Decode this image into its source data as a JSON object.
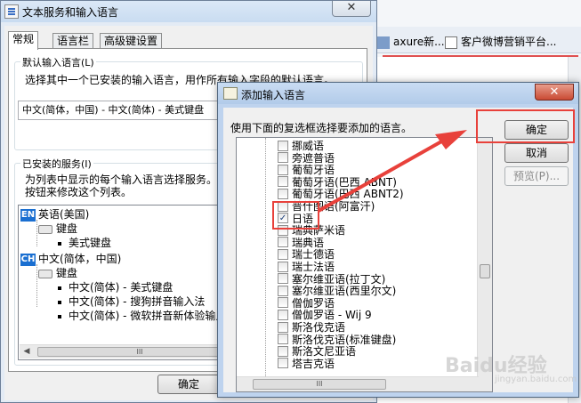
{
  "background": {
    "tabs": [
      {
        "label": "axure新..."
      },
      {
        "label": "客户微博营销平台..."
      }
    ]
  },
  "main_window": {
    "title": "文本服务和输入语言",
    "close_glyph": "✕",
    "tabs": [
      {
        "label": "常规",
        "active": true
      },
      {
        "label": "语言栏",
        "active": false
      },
      {
        "label": "高级键设置",
        "active": false
      }
    ],
    "default_group": {
      "title": "默认输入语言(L)",
      "description": "选择其中一个已安装的输入语言，用作所有输入字段的默认语言。",
      "selected_value": "中文(简体，中国) - 中文(简体) - 美式键盘"
    },
    "installed_group": {
      "title": "已安装的服务(I)",
      "description_line1": "为列表中显示的每个输入语言选择服务。使用\"添加\"和\"删除\"",
      "description_line2": "按钮来修改这个列表。",
      "items": [
        {
          "badge": "EN",
          "label": "英语(美国)"
        },
        {
          "label": "键盘"
        },
        {
          "label": "美式键盘"
        },
        {
          "badge": "CH",
          "label": "中文(简体，中国)"
        },
        {
          "label": "键盘"
        },
        {
          "label": "中文(简体) - 美式键盘"
        },
        {
          "label": "中文(简体) - 搜狗拼音输入法"
        },
        {
          "label": "中文(简体) - 微软拼音新体验输入风格"
        }
      ],
      "scroll_grip": "III"
    },
    "ok_button": "确定"
  },
  "add_dialog": {
    "title": "添加输入语言",
    "close_glyph": "✕",
    "prompt": "使用下面的复选框选择要添加的语言。",
    "languages": [
      {
        "label": "挪威语",
        "checked": false
      },
      {
        "label": "旁遮普语",
        "checked": false
      },
      {
        "label": "葡萄牙语",
        "checked": false
      },
      {
        "label": "葡萄牙语(巴西 ABNT)",
        "checked": false
      },
      {
        "label": "葡萄牙语(巴西 ABNT2)",
        "checked": false
      },
      {
        "label": "普什图语(阿富汗)",
        "checked": false
      },
      {
        "label": "日语",
        "checked": true
      },
      {
        "label": "瑞典萨米语",
        "checked": false
      },
      {
        "label": "瑞典语",
        "checked": false
      },
      {
        "label": "瑞士德语",
        "checked": false
      },
      {
        "label": "瑞士法语",
        "checked": false
      },
      {
        "label": "塞尔维亚语(拉丁文)",
        "checked": false
      },
      {
        "label": "塞尔维亚语(西里尔文)",
        "checked": false
      },
      {
        "label": "僧伽罗语",
        "checked": false
      },
      {
        "label": "僧伽罗语 - Wij 9",
        "checked": false
      },
      {
        "label": "斯洛伐克语",
        "checked": false
      },
      {
        "label": "斯洛伐克语(标准键盘)",
        "checked": false
      },
      {
        "label": "斯洛文尼亚语",
        "checked": false
      },
      {
        "label": "塔吉克语",
        "checked": false
      }
    ],
    "check_glyph": "✓",
    "buttons": {
      "ok": "确定",
      "cancel": "取消",
      "preview": "预览(P)..."
    },
    "scroll_grip": "III"
  },
  "watermark": {
    "text": "Baidu经验",
    "sub": "jingyan.baidu.com"
  },
  "annotation_color": "#e8413b"
}
